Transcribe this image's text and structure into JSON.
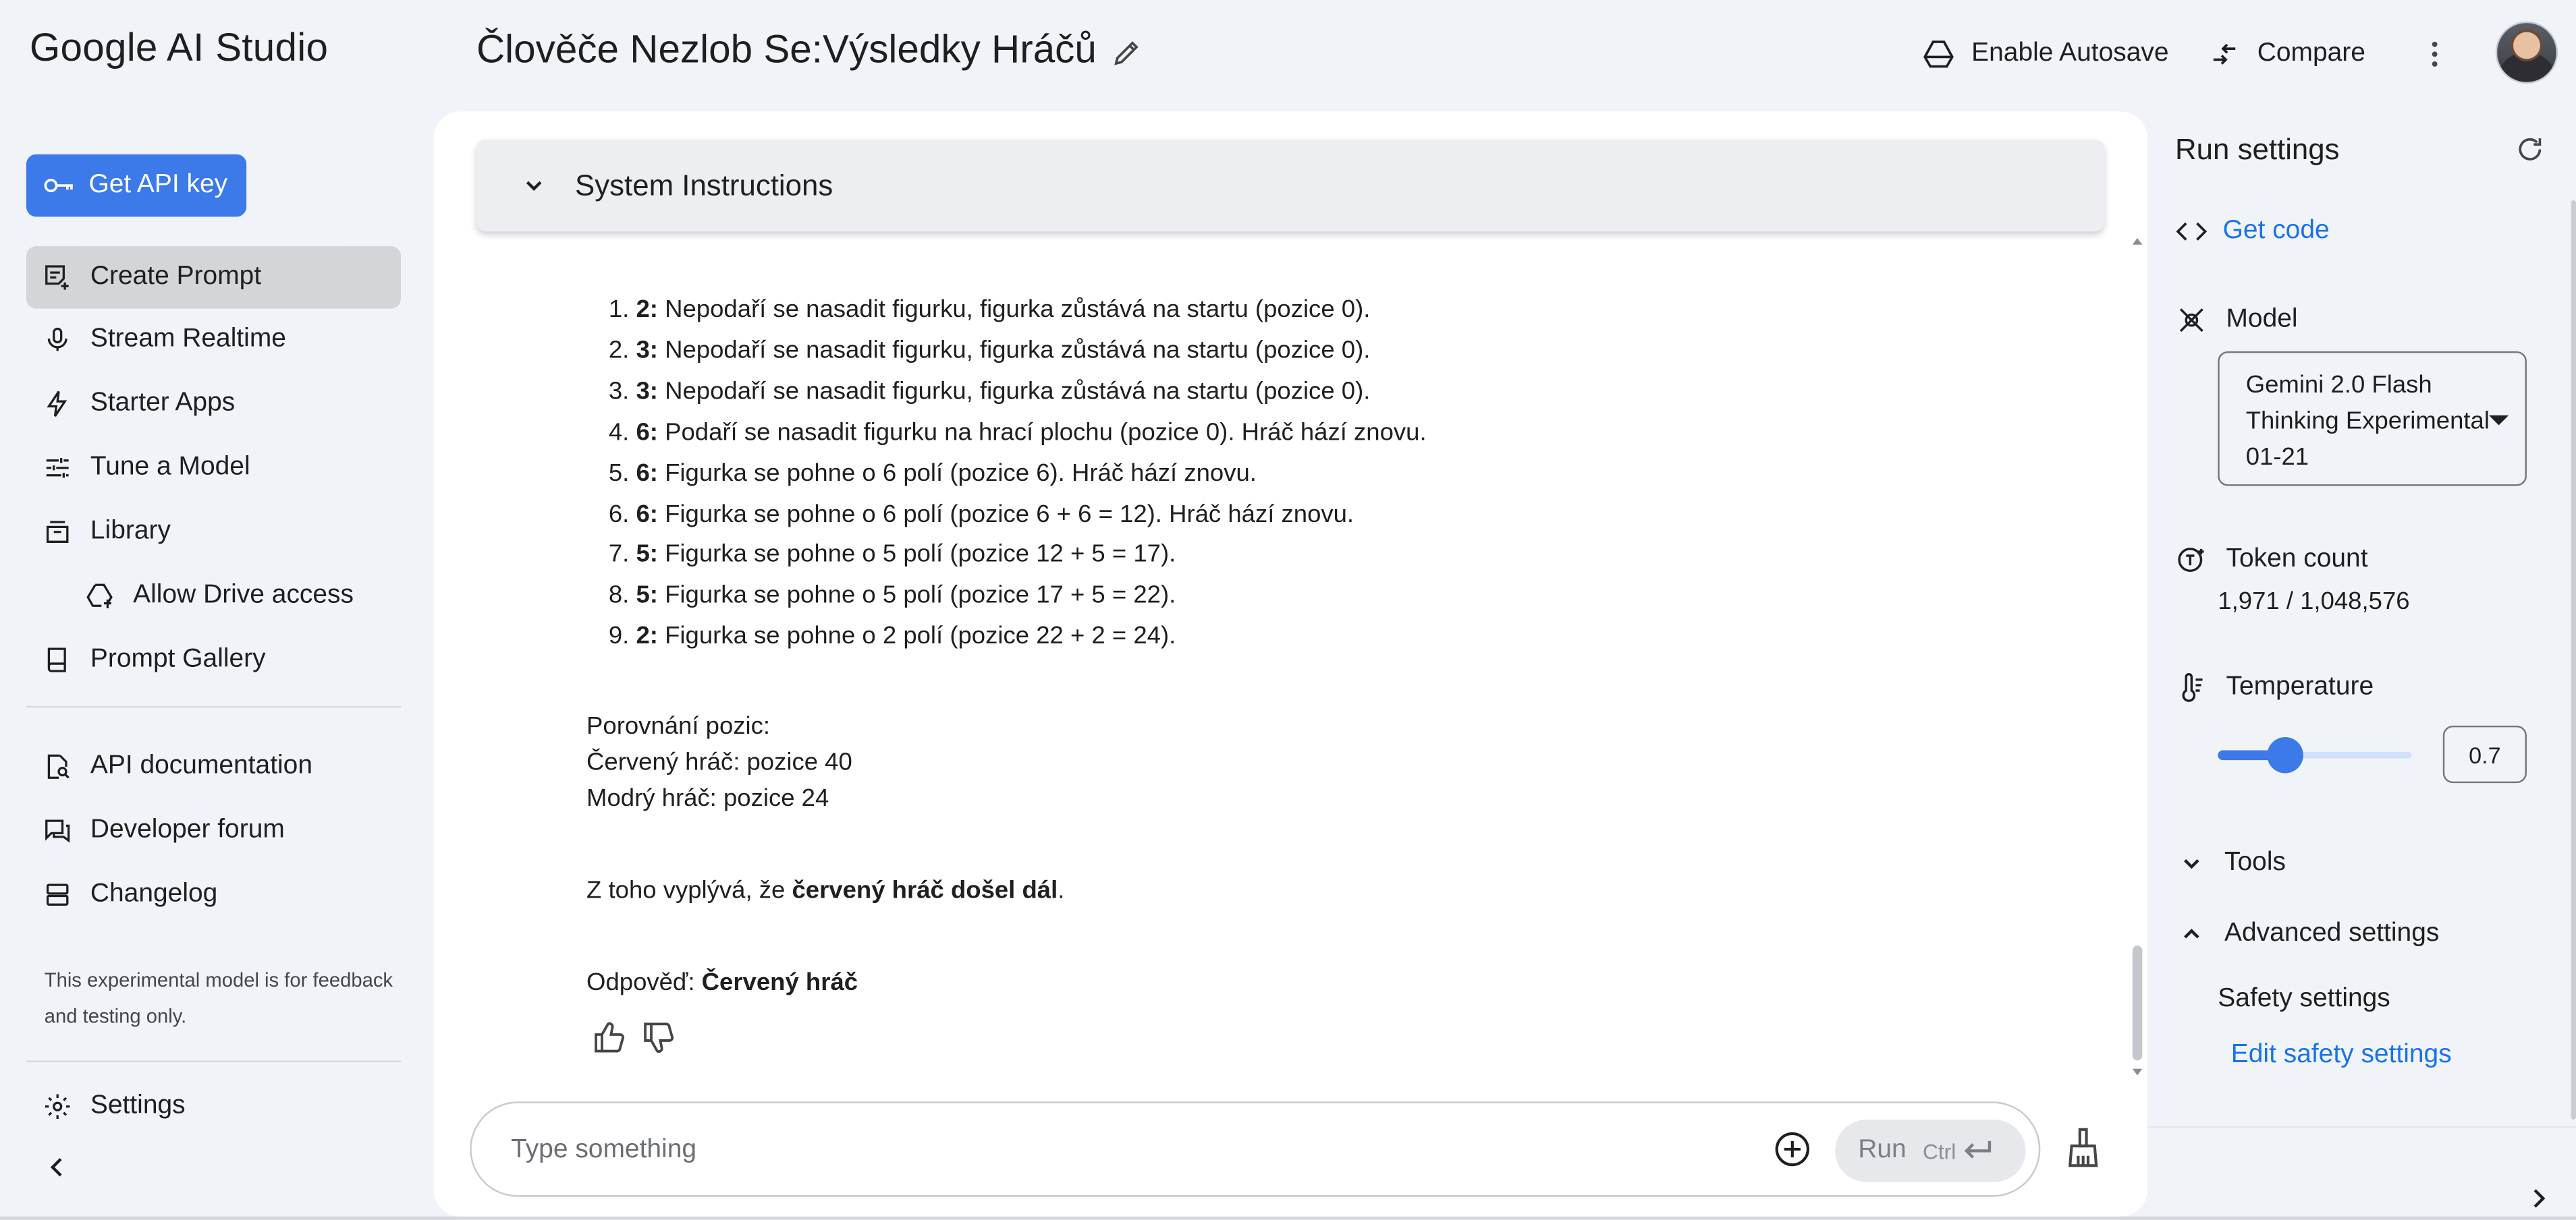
{
  "header": {
    "brand": "Google AI Studio",
    "title": "Člověče Nezlob Se:Výsledky Hráčů",
    "autosave_label": "Enable Autosave",
    "compare_label": "Compare"
  },
  "sidebar": {
    "api_key_label": "Get API key",
    "items": [
      {
        "label": "Create Prompt",
        "icon": "create-prompt-icon",
        "active": true
      },
      {
        "label": "Stream Realtime",
        "icon": "microphone-icon"
      },
      {
        "label": "Starter Apps",
        "icon": "bolt-icon"
      },
      {
        "label": "Tune a Model",
        "icon": "tune-icon"
      },
      {
        "label": "Library",
        "icon": "library-icon"
      },
      {
        "label": "Allow Drive access",
        "icon": "drive-add-icon"
      },
      {
        "label": "Prompt Gallery",
        "icon": "book-icon"
      },
      {
        "label": "API documentation",
        "icon": "doc-search-icon"
      },
      {
        "label": "Developer forum",
        "icon": "forum-icon"
      },
      {
        "label": "Changelog",
        "icon": "changelog-icon"
      }
    ],
    "disclaimer": "This experimental model is for feedback and testing only.",
    "settings_label": "Settings"
  },
  "main": {
    "system_instructions_label": "System Instructions",
    "steps": [
      {
        "num": "1.",
        "roll": "2:",
        "text": " Nepodaří se nasadit figurku, figurka zůstává na startu (pozice 0)."
      },
      {
        "num": "2.",
        "roll": "3:",
        "text": " Nepodaří se nasadit figurku, figurka zůstává na startu (pozice 0)."
      },
      {
        "num": "3.",
        "roll": "3:",
        "text": " Nepodaří se nasadit figurku, figurka zůstává na startu (pozice 0)."
      },
      {
        "num": "4.",
        "roll": "6:",
        "text": " Podaří se nasadit figurku na hrací plochu (pozice 0). Hráč hází znovu."
      },
      {
        "num": "5.",
        "roll": "6:",
        "text": " Figurka se pohne o 6 polí (pozice 6). Hráč hází znovu."
      },
      {
        "num": "6.",
        "roll": "6:",
        "text": " Figurka se pohne o 6 polí (pozice 6 + 6 = 12). Hráč hází znovu."
      },
      {
        "num": "7.",
        "roll": "5:",
        "text": " Figurka se pohne o 5 polí (pozice 12 + 5 = 17)."
      },
      {
        "num": "8.",
        "roll": "5:",
        "text": " Figurka se pohne o 5 polí (pozice 17 + 5 = 22)."
      },
      {
        "num": "9.",
        "roll": "2:",
        "text": " Figurka se pohne o 2 polí (pozice 22 + 2 = 24)."
      }
    ],
    "comparison_heading": "Porovnání pozic:",
    "red_position": "Červený hráč: pozice 40",
    "blue_position": "Modrý hráč: pozice 24",
    "conclusion_prefix": "Z toho vyplývá, že ",
    "conclusion_bold": "červený hráč došel dál",
    "conclusion_suffix": ".",
    "answer_prefix": "Odpověď: ",
    "answer_bold": "Červený hráč",
    "input_placeholder": "Type something",
    "run_label": "Run",
    "run_shortcut": "Ctrl"
  },
  "run_settings": {
    "title": "Run settings",
    "get_code_label": "Get code",
    "model_label": "Model",
    "model_value": "Gemini 2.0 Flash Thinking Experimental 01-21",
    "token_label": "Token count",
    "token_value": "1,971 / 1,048,576",
    "temperature_label": "Temperature",
    "temperature_value": "0.7",
    "temperature_fraction": 0.35,
    "tools_label": "Tools",
    "advanced_label": "Advanced settings",
    "safety_label": "Safety settings",
    "edit_safety_label": "Edit safety settings"
  },
  "colors": {
    "accent": "#3b7ae8",
    "link": "#1a73e8",
    "background": "#f0f4f9"
  }
}
